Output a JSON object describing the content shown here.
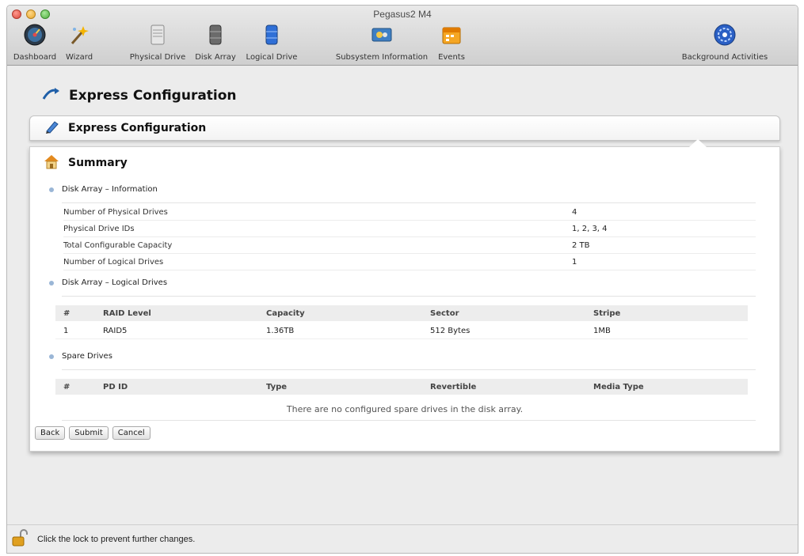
{
  "window": {
    "title": "Pegasus2 M4"
  },
  "toolbar": {
    "items": [
      {
        "label": "Dashboard",
        "icon": "dashboard-gauge-icon"
      },
      {
        "label": "Wizard",
        "icon": "wizard-wand-icon"
      },
      {
        "label": "Physical Drive",
        "icon": "physical-drive-icon"
      },
      {
        "label": "Disk Array",
        "icon": "disk-array-icon"
      },
      {
        "label": "Logical Drive",
        "icon": "logical-drive-icon"
      },
      {
        "label": "Subsystem Information",
        "icon": "subsystem-info-icon"
      },
      {
        "label": "Events",
        "icon": "events-calendar-icon"
      },
      {
        "label": "Background Activities",
        "icon": "background-activities-icon"
      }
    ]
  },
  "page": {
    "heading": "Express Configuration"
  },
  "section": {
    "title": "Express Configuration"
  },
  "summary": {
    "title": "Summary",
    "disk_array_info": {
      "heading": "Disk Array – Information",
      "rows": [
        {
          "label": "Number of Physical Drives",
          "value": "4"
        },
        {
          "label": "Physical Drive IDs",
          "value": "1, 2, 3, 4"
        },
        {
          "label": "Total Configurable Capacity",
          "value": "2 TB"
        },
        {
          "label": "Number of Logical Drives",
          "value": "1"
        }
      ]
    },
    "logical_drives": {
      "heading": "Disk Array – Logical Drives",
      "columns": [
        "#",
        "RAID Level",
        "Capacity",
        "Sector",
        "Stripe"
      ],
      "rows": [
        {
          "num": "1",
          "raid": "RAID5",
          "capacity": "1.36TB",
          "sector": "512 Bytes",
          "stripe": "1MB"
        }
      ]
    },
    "spare_drives": {
      "heading": "Spare Drives",
      "columns": [
        "#",
        "PD ID",
        "Type",
        "Revertible",
        "Media Type"
      ],
      "empty_message": "There are no configured spare drives in the disk array."
    }
  },
  "buttons": {
    "back": "Back",
    "submit": "Submit",
    "cancel": "Cancel"
  },
  "status": {
    "lock_text": "Click the lock to prevent further changes."
  },
  "colors": {
    "bullet": "#9ab6d6",
    "table_header_bg": "#ededed",
    "panel_bg": "#ffffff"
  }
}
